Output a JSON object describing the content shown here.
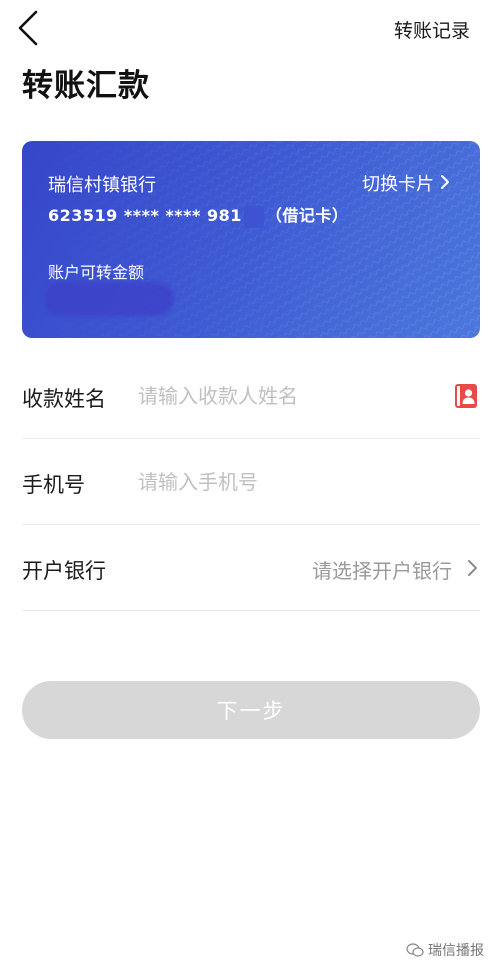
{
  "nav": {
    "back_icon": "chevron-left-icon",
    "records_label": "转账记录"
  },
  "page": {
    "title": "转账汇款"
  },
  "card": {
    "bank_name": "瑞信村镇银行",
    "switch_label": "切换卡片",
    "switch_icon": "chevron-right-icon",
    "number_prefix": "623519 **** **** 981",
    "card_type": "（借记卡）",
    "balance_label": "账户可转金额",
    "gradient_colors": [
      "#3646c9",
      "#4b78dc"
    ]
  },
  "form": {
    "payee_name": {
      "label": "收款姓名",
      "placeholder": "请输入收款人姓名",
      "value": "",
      "icon": "contact-book-icon",
      "icon_color": "#e84a4a"
    },
    "phone": {
      "label": "手机号",
      "placeholder": "请输入手机号",
      "value": ""
    },
    "bank": {
      "label": "开户银行",
      "value": "请选择开户银行",
      "icon": "chevron-right-icon"
    }
  },
  "actions": {
    "next_label": "下一步",
    "next_disabled_color": "#d7d7d7"
  },
  "watermark": {
    "text": "瑞信播报",
    "icon": "wechat-icon"
  }
}
